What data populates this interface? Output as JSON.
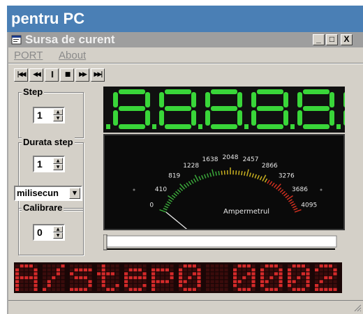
{
  "banner": {
    "text": "pentru PC"
  },
  "window": {
    "title": "Sursa de curent",
    "buttons": {
      "minimize": "_",
      "maximize": "□",
      "close": "X"
    }
  },
  "menu": [
    {
      "label": "PORT"
    },
    {
      "label": "About"
    }
  ],
  "transport": [
    {
      "icon": "skip-start-icon",
      "glyph": "|◀◀"
    },
    {
      "icon": "rewind-icon",
      "glyph": "◀◀"
    },
    {
      "icon": "pause-icon",
      "glyph": "||"
    },
    {
      "icon": "stop-icon",
      "glyph": "■"
    },
    {
      "icon": "fast-forward-icon",
      "glyph": "▶▶"
    },
    {
      "icon": "skip-end-icon",
      "glyph": "▶▶|"
    }
  ],
  "step": {
    "label": "Step",
    "value": "1"
  },
  "durata": {
    "label": "Durata step",
    "value": "1",
    "unit": "milisecun"
  },
  "calibrare": {
    "label": "Calibrare",
    "value": "0"
  },
  "seven_segment": {
    "color": "#39d639"
  },
  "meter": {
    "label": "Ampermetrul",
    "scale": [
      "0",
      "410",
      "819",
      "1228",
      "1638",
      "2048",
      "2457",
      "2866",
      "3276",
      "3686",
      "4095"
    ],
    "needle_value": 0
  },
  "slider": {
    "position": 0
  },
  "dot_matrix": {
    "text": "A/step0 0002",
    "color": "#d42a2a"
  }
}
